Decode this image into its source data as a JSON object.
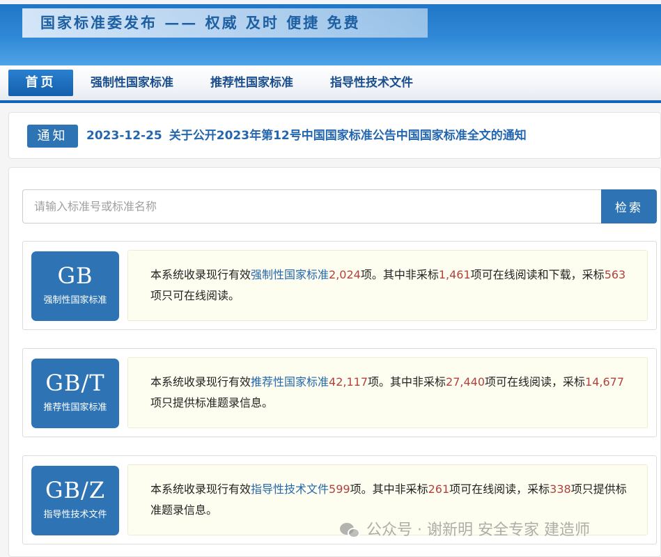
{
  "header": {
    "banner_text": "国家标准委发布 —— 权威 及时 便捷 免费",
    "colors": {
      "brand": "#1e74c4",
      "accent": "#2e74b5",
      "highlight_number": "#b0413e"
    }
  },
  "nav": {
    "items": [
      {
        "label": "首页",
        "active": true
      },
      {
        "label": "强制性国家标准",
        "active": false
      },
      {
        "label": "推荐性国家标准",
        "active": false
      },
      {
        "label": "指导性技术文件",
        "active": false
      }
    ]
  },
  "notice": {
    "tag": "通知",
    "date": "2023-12-25",
    "title": "关于公开2023年第12号中国国家标准公告中国国家标准全文的通知"
  },
  "search": {
    "placeholder": "请输入标准号或标准名称",
    "button_label": "检索"
  },
  "categories": [
    {
      "code": "GB",
      "name": "强制性国家标准",
      "desc": {
        "t1": "本系统收录现行有效",
        "link": "强制性国家标准",
        "total": "2,024",
        "t2": "项。其中非采标",
        "n1": "1,461",
        "t3": "项可在线阅读和下载，采标",
        "n2": "563",
        "t4": "项只可在线阅读。"
      }
    },
    {
      "code": "GB/T",
      "name": "推荐性国家标准",
      "desc": {
        "t1": "本系统收录现行有效",
        "link": "推荐性国家标准",
        "total": "42,117",
        "t2": "项。其中非采标",
        "n1": "27,440",
        "t3": "项可在线阅读，采标",
        "n2": "14,677",
        "t4": "项只提供标准题录信息。"
      }
    },
    {
      "code": "GB/Z",
      "name": "指导性技术文件",
      "desc": {
        "t1": "本系统收录现行有效",
        "link": "指导性技术文件",
        "total": "599",
        "t2": "项。其中非采标",
        "n1": "261",
        "t3": "项可在线阅读，采标",
        "n2": "338",
        "t4": "项只提供标准题录信息。"
      }
    }
  ],
  "watermark": {
    "icon": "wechat-icon",
    "text": "公众号 · 谢新明 安全专家 建造师"
  }
}
